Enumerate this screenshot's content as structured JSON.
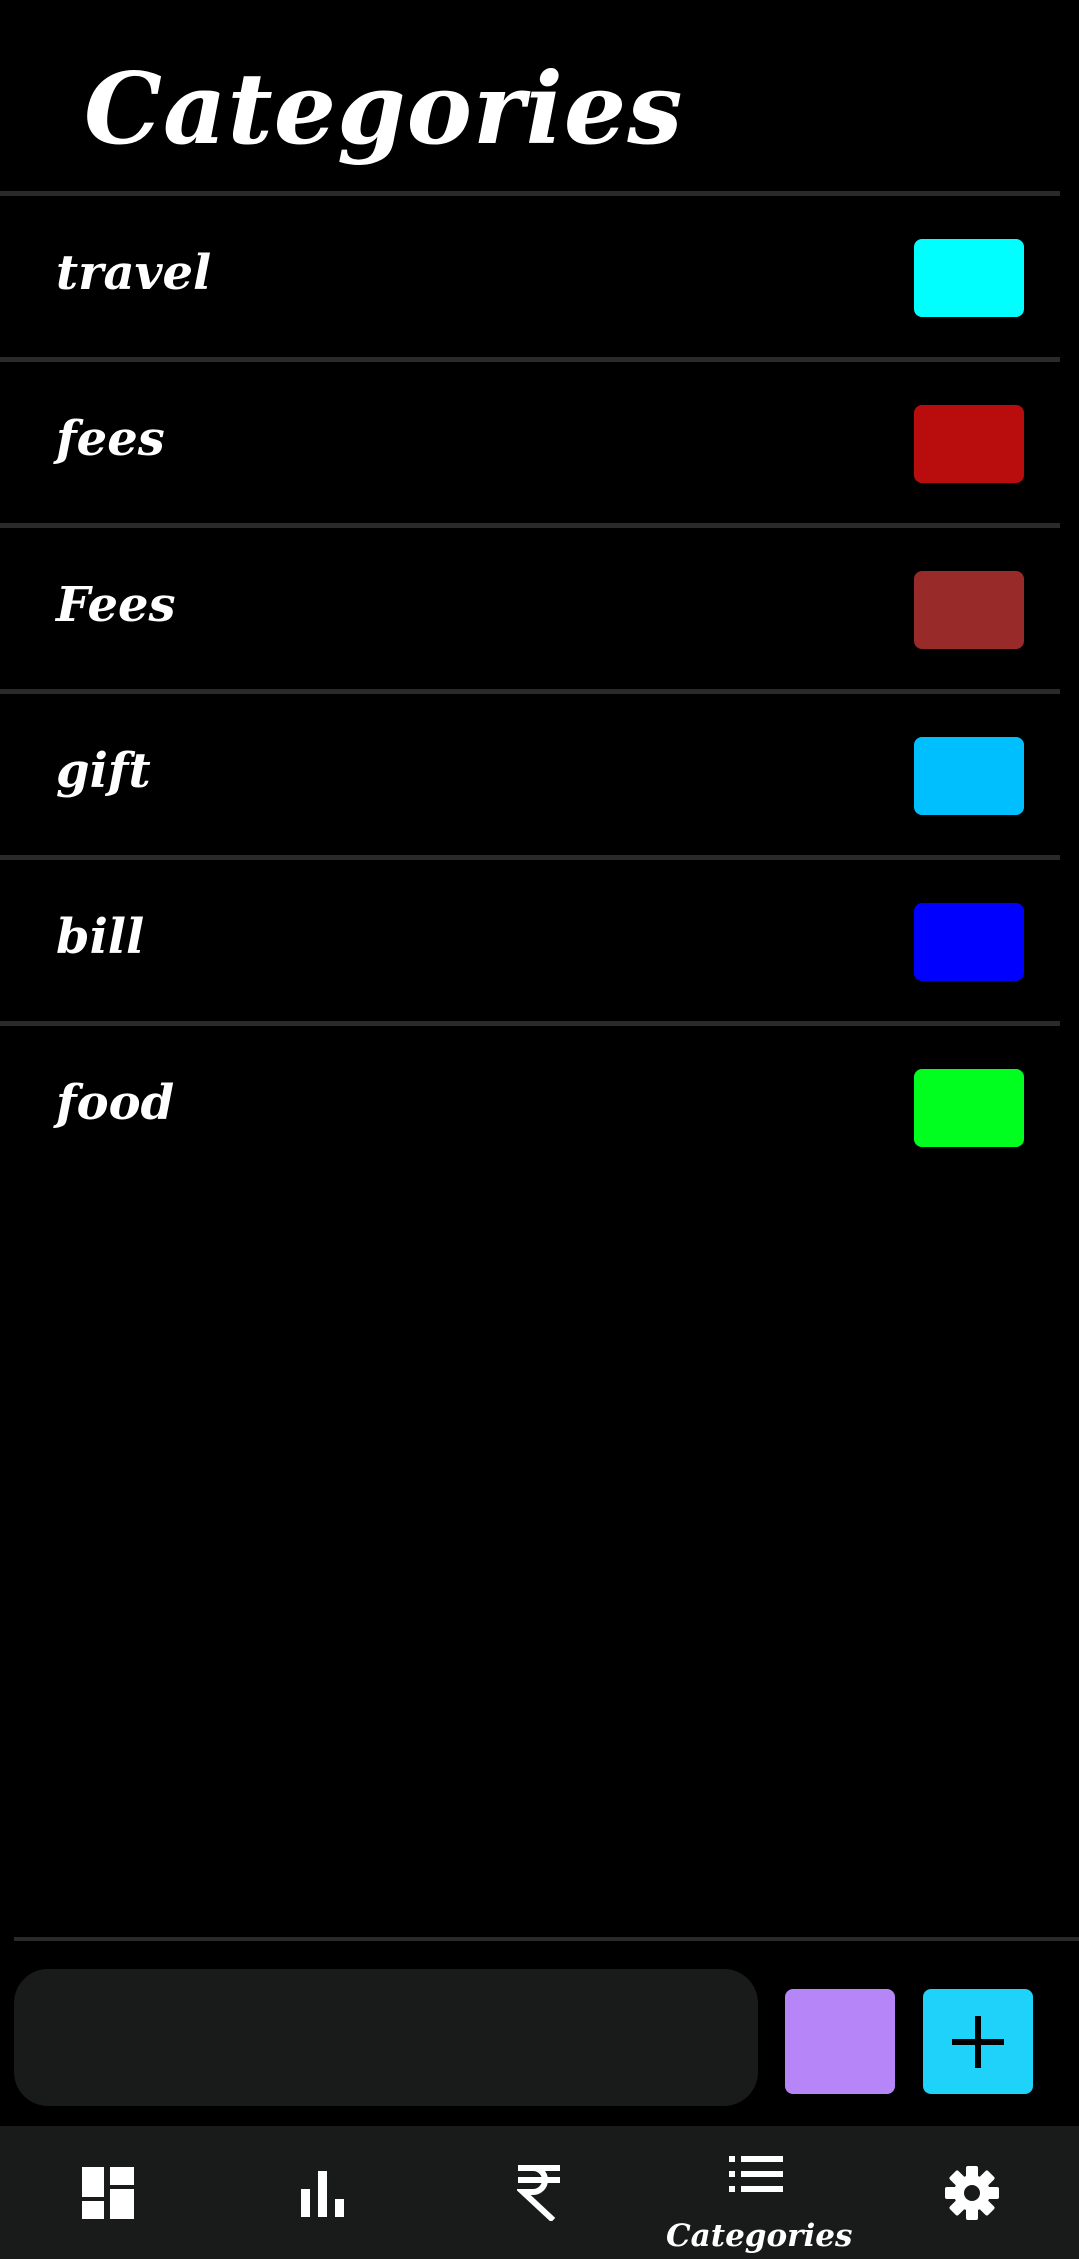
{
  "header": {
    "title": "Categories"
  },
  "categories": [
    {
      "name": "travel",
      "color": "#00ffff"
    },
    {
      "name": "fees",
      "color": "#b90d0d"
    },
    {
      "name": "Fees",
      "color": "#982a2a"
    },
    {
      "name": "gift",
      "color": "#00bfff"
    },
    {
      "name": "bill",
      "color": "#0000ff"
    },
    {
      "name": "food",
      "color": "#00ff1e"
    }
  ],
  "add_form": {
    "name_value": "",
    "selected_color": "#b685f7",
    "add_button_color": "#1ed2fa",
    "add_icon": "plus-icon"
  },
  "bottom_nav": {
    "items": [
      {
        "id": "dashboard",
        "icon": "dashboard-icon",
        "label": ""
      },
      {
        "id": "stats",
        "icon": "bar-chart-icon",
        "label": ""
      },
      {
        "id": "transactions",
        "icon": "rupee-icon",
        "label": ""
      },
      {
        "id": "categories",
        "icon": "list-icon",
        "label": "Categories",
        "active": true
      },
      {
        "id": "settings",
        "icon": "gear-icon",
        "label": ""
      }
    ]
  }
}
